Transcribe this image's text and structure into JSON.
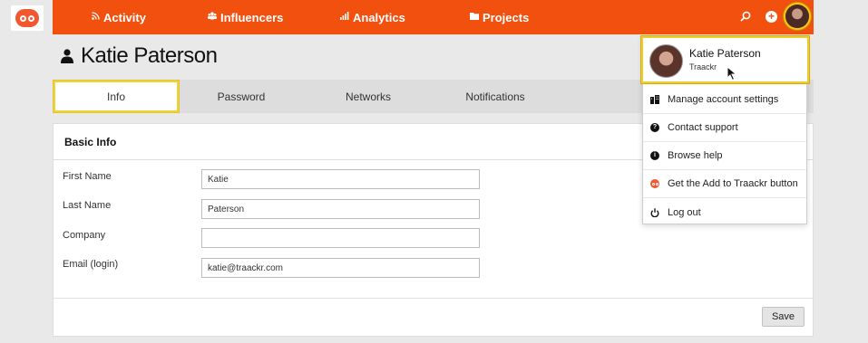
{
  "brand": {
    "logo_icon": "traackr-logo-icon",
    "accent_color": "#f1500f",
    "highlight_color": "#f0cc2c"
  },
  "nav": {
    "items": [
      {
        "label": "Activity",
        "icon": "rss-icon"
      },
      {
        "label": "Influencers",
        "icon": "influencers-icon"
      },
      {
        "label": "Analytics",
        "icon": "bar-chart-icon"
      },
      {
        "label": "Projects",
        "icon": "folder-icon"
      }
    ],
    "actions": [
      "search-icon",
      "add-icon",
      "avatar"
    ]
  },
  "page": {
    "title": "Katie Paterson",
    "title_icon": "person-icon"
  },
  "tabs": [
    {
      "label": "Info",
      "active": true
    },
    {
      "label": "Password"
    },
    {
      "label": "Networks"
    },
    {
      "label": "Notifications"
    }
  ],
  "basic_info": {
    "title": "Basic Info",
    "fields": [
      {
        "label": "First Name",
        "value": "Katie"
      },
      {
        "label": "Last Name",
        "value": "Paterson"
      },
      {
        "label": "Company",
        "value": ""
      },
      {
        "label": "Email (login)",
        "value": "katie@traackr.com"
      }
    ],
    "save_label": "Save"
  },
  "dropdown": {
    "name": "Katie Paterson",
    "org": "Traackr",
    "items": [
      {
        "label": "Manage account settings",
        "icon": "building-icon"
      },
      {
        "label": "Contact support",
        "icon": "question-icon"
      },
      {
        "label": "Browse help",
        "icon": "info-icon"
      },
      {
        "label": "Get the Add to Traackr button",
        "icon": "traackr-icon"
      },
      {
        "label": "Log out",
        "icon": "power-icon"
      }
    ]
  }
}
